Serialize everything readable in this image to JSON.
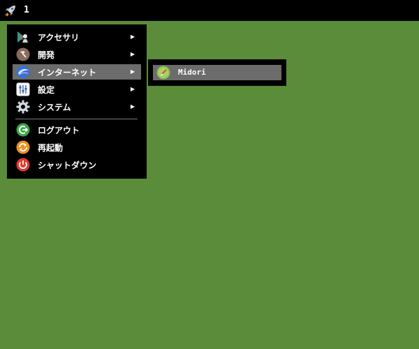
{
  "taskbar": {
    "launcher_icon": "rocket-icon",
    "workspace": "1"
  },
  "menu": {
    "items": [
      {
        "label": "アクセサリ",
        "icon": "accessories-icon",
        "submenu": true
      },
      {
        "label": "開発",
        "icon": "hammer-icon",
        "submenu": true
      },
      {
        "label": "インターネット",
        "icon": "internet-globe-icon",
        "submenu": true,
        "active": true
      },
      {
        "label": "設定",
        "icon": "settings-sliders-icon",
        "submenu": true
      },
      {
        "label": "システム",
        "icon": "gear-icon",
        "submenu": true
      },
      {
        "label": "ログアウト",
        "icon": "logout-icon",
        "submenu": false
      },
      {
        "label": "再起動",
        "icon": "restart-icon",
        "submenu": false
      },
      {
        "label": "シャットダウン",
        "icon": "power-icon",
        "submenu": false
      }
    ],
    "arrow": "▶"
  },
  "submenu": {
    "items": [
      {
        "label": "Midori",
        "icon": "midori-browser-icon"
      }
    ]
  },
  "colors": {
    "desktop": "#5a8c3a",
    "menu_bg": "#000000",
    "highlight": "#6c6c6c"
  }
}
